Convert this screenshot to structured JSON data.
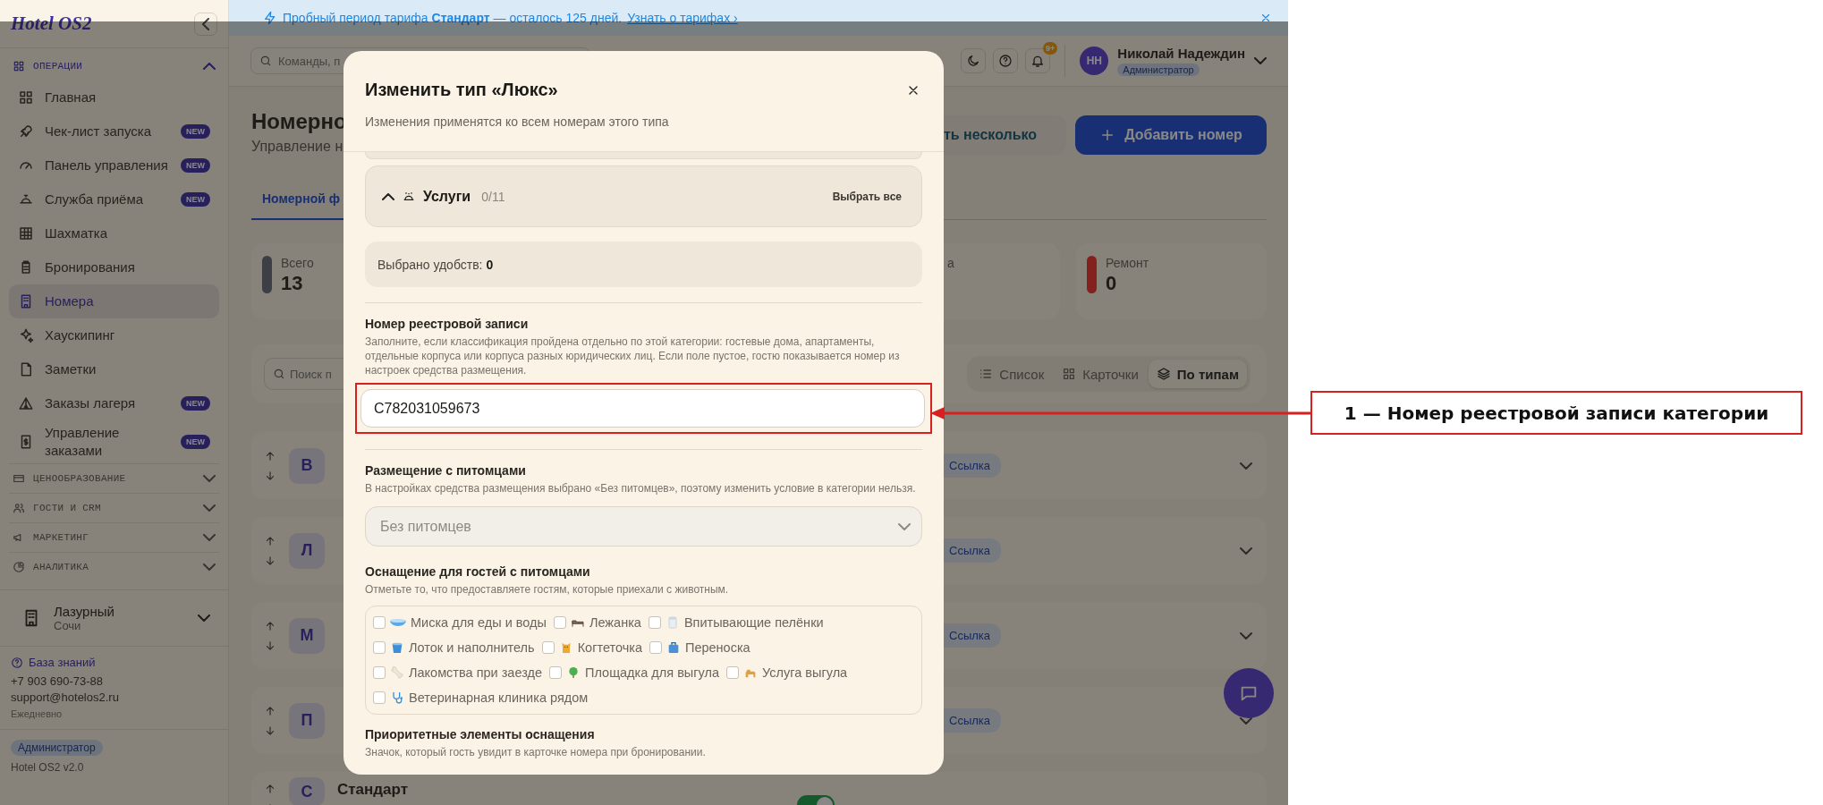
{
  "banner": {
    "text": "Пробный период тарифа **Стандарт** — осталось 125 дней.",
    "link": "Узнать о тарифах ›"
  },
  "sidebar": {
    "logo": "Hotel OS2",
    "sections": [
      {
        "title": "ОПЕРАЦИИ",
        "expanded": true,
        "items": [
          {
            "label": "Главная",
            "selected": false
          },
          {
            "label": "Чек-лист запуска",
            "badge": "NEW",
            "selected": false
          },
          {
            "label": "Панель управления",
            "badge": "NEW",
            "selected": false
          },
          {
            "label": "Служба приёма",
            "badge": "NEW",
            "selected": false
          },
          {
            "label": "Шахматка",
            "selected": false
          },
          {
            "label": "Бронирования",
            "selected": false
          },
          {
            "label": "Номера",
            "selected": true
          },
          {
            "label": "Хаускипинг",
            "selected": false
          },
          {
            "label": "Заметки",
            "selected": false
          },
          {
            "label": "Заказы лагеря",
            "badge": "NEW",
            "selected": false
          },
          {
            "label": "Управление заказами",
            "badge": "NEW",
            "selected": false
          }
        ]
      },
      {
        "title": "ЦЕНООБРАЗОВАНИЕ",
        "expanded": false
      },
      {
        "title": "ГОСТИ И CRM",
        "expanded": false
      },
      {
        "title": "МАРКЕТИНГ",
        "expanded": false
      },
      {
        "title": "АНАЛИТИКА",
        "expanded": false
      }
    ],
    "property": {
      "name": "Лазурный",
      "city": "Сочи"
    },
    "help": {
      "link": "База знаний",
      "phone": "+7 903 690-73-88",
      "email": "support@hotelos2.ru",
      "hours": "Ежедневно"
    },
    "role": "Администратор",
    "version": "Hotel OS2 v2.0"
  },
  "header": {
    "search_placeholder": "Команды, п",
    "notifications": "9+",
    "user": {
      "initials": "НН",
      "name": "Николай Надеждин",
      "role": "Администратор"
    }
  },
  "page": {
    "title": "Номерно",
    "subtitle": "Управление н",
    "buttons": [
      {
        "label": "ть несколько",
        "kind": "secondary"
      },
      {
        "label": "Добавить номер",
        "kind": "primary"
      }
    ],
    "tab": {
      "label": "Номерной ф",
      "selected": true
    },
    "stats": [
      {
        "label": "Всего",
        "value": "13",
        "color": "#3d3f46"
      },
      {
        "label": "а"
      },
      {
        "label": "Ремонт",
        "value": "0",
        "color": "#84211f"
      }
    ],
    "search_placeholder": "Поиск п",
    "views": [
      {
        "label": "Список",
        "selected": false
      },
      {
        "label": "Карточки",
        "selected": false
      },
      {
        "label": "По типам",
        "selected": true
      }
    ],
    "room_types": [
      {
        "letter": "В",
        "link": "Ссылка"
      },
      {
        "letter": "Л",
        "link": "Ссылка"
      },
      {
        "letter": "М",
        "link": "Ссылка"
      },
      {
        "letter": "П",
        "link": "Ссылка"
      },
      {
        "letter": "С",
        "name": "Стандарт",
        "on": true
      }
    ]
  },
  "modal": {
    "title": "Изменить тип «Люкс»",
    "subtitle": "Изменения применятся ко всем номерам этого типа",
    "group": {
      "title": "Услуги",
      "count": "0/11",
      "expanded": true,
      "action": "Выбрать все"
    },
    "selected_summary": "Выбрано удобств: **0**",
    "registry": {
      "label": "Номер реестровой записи",
      "help": "Заполните, если классификация пройдена отдельно по этой категории: гостевые дома, апартаменты, отдельные корпуса или корпуса разных юридических лиц. Если поле пустое, гостю показывается номер из настроек средства размещения.",
      "value": "C782031059673"
    },
    "pets": {
      "label": "Размещение с питомцами",
      "help": "В настройках средства размещения выбрано «Без питомцев», поэтому изменить условие в категории нельзя.",
      "select": {
        "value": "Без питомцев",
        "disabled": true
      }
    },
    "pet_equipment": {
      "label": "Оснащение для гостей с питомцами",
      "help": "Отметьте то, что предоставляете гостям, которые приехали с животным.",
      "options": [
        {
          "label": "Миска для еды и воды",
          "checked": false
        },
        {
          "label": "Лежанка",
          "checked": false
        },
        {
          "label": "Впитывающие пелёнки",
          "checked": false
        },
        {
          "label": "Лоток и наполнитель",
          "checked": false
        },
        {
          "label": "Когтеточка",
          "checked": false
        },
        {
          "label": "Переноска",
          "checked": false
        },
        {
          "label": "Лакомства при заезде",
          "checked": false
        },
        {
          "label": "Площадка для выгула",
          "checked": false
        },
        {
          "label": "Услуга выгула",
          "checked": false
        },
        {
          "label": "Ветеринарная клиника рядом",
          "checked": false
        }
      ]
    },
    "priority": {
      "label": "Приоритетные элементы оснащения",
      "help": "Значок, который гость увидит в карточке номера при бронировании."
    }
  },
  "annotation": {
    "label": "1 — Номер реестровой записи категории"
  }
}
